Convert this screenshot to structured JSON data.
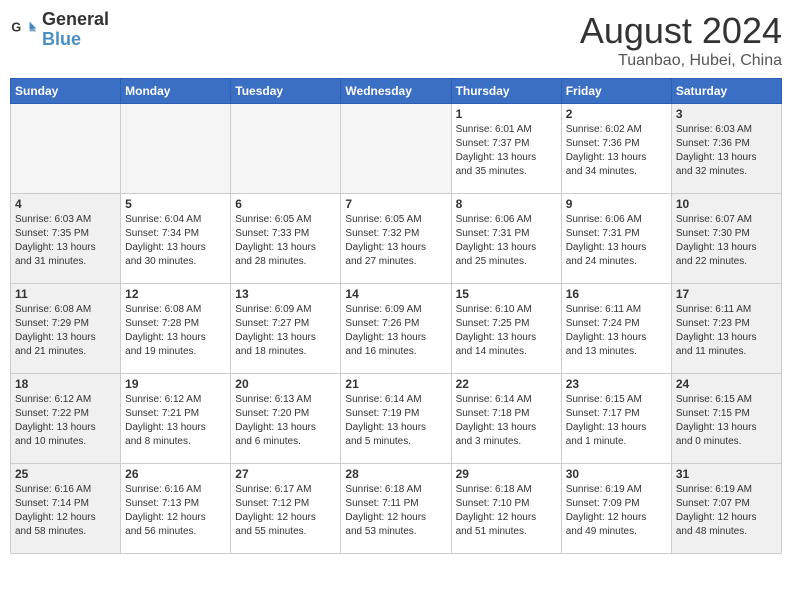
{
  "header": {
    "logo_line1": "General",
    "logo_line2": "Blue",
    "main_title": "August 2024",
    "sub_title": "Tuanbao, Hubei, China"
  },
  "days_of_week": [
    "Sunday",
    "Monday",
    "Tuesday",
    "Wednesday",
    "Thursday",
    "Friday",
    "Saturday"
  ],
  "weeks": [
    [
      {
        "day": "",
        "info": ""
      },
      {
        "day": "",
        "info": ""
      },
      {
        "day": "",
        "info": ""
      },
      {
        "day": "",
        "info": ""
      },
      {
        "day": "1",
        "info": "Sunrise: 6:01 AM\nSunset: 7:37 PM\nDaylight: 13 hours\nand 35 minutes."
      },
      {
        "day": "2",
        "info": "Sunrise: 6:02 AM\nSunset: 7:36 PM\nDaylight: 13 hours\nand 34 minutes."
      },
      {
        "day": "3",
        "info": "Sunrise: 6:03 AM\nSunset: 7:36 PM\nDaylight: 13 hours\nand 32 minutes."
      }
    ],
    [
      {
        "day": "4",
        "info": "Sunrise: 6:03 AM\nSunset: 7:35 PM\nDaylight: 13 hours\nand 31 minutes."
      },
      {
        "day": "5",
        "info": "Sunrise: 6:04 AM\nSunset: 7:34 PM\nDaylight: 13 hours\nand 30 minutes."
      },
      {
        "day": "6",
        "info": "Sunrise: 6:05 AM\nSunset: 7:33 PM\nDaylight: 13 hours\nand 28 minutes."
      },
      {
        "day": "7",
        "info": "Sunrise: 6:05 AM\nSunset: 7:32 PM\nDaylight: 13 hours\nand 27 minutes."
      },
      {
        "day": "8",
        "info": "Sunrise: 6:06 AM\nSunset: 7:31 PM\nDaylight: 13 hours\nand 25 minutes."
      },
      {
        "day": "9",
        "info": "Sunrise: 6:06 AM\nSunset: 7:31 PM\nDaylight: 13 hours\nand 24 minutes."
      },
      {
        "day": "10",
        "info": "Sunrise: 6:07 AM\nSunset: 7:30 PM\nDaylight: 13 hours\nand 22 minutes."
      }
    ],
    [
      {
        "day": "11",
        "info": "Sunrise: 6:08 AM\nSunset: 7:29 PM\nDaylight: 13 hours\nand 21 minutes."
      },
      {
        "day": "12",
        "info": "Sunrise: 6:08 AM\nSunset: 7:28 PM\nDaylight: 13 hours\nand 19 minutes."
      },
      {
        "day": "13",
        "info": "Sunrise: 6:09 AM\nSunset: 7:27 PM\nDaylight: 13 hours\nand 18 minutes."
      },
      {
        "day": "14",
        "info": "Sunrise: 6:09 AM\nSunset: 7:26 PM\nDaylight: 13 hours\nand 16 minutes."
      },
      {
        "day": "15",
        "info": "Sunrise: 6:10 AM\nSunset: 7:25 PM\nDaylight: 13 hours\nand 14 minutes."
      },
      {
        "day": "16",
        "info": "Sunrise: 6:11 AM\nSunset: 7:24 PM\nDaylight: 13 hours\nand 13 minutes."
      },
      {
        "day": "17",
        "info": "Sunrise: 6:11 AM\nSunset: 7:23 PM\nDaylight: 13 hours\nand 11 minutes."
      }
    ],
    [
      {
        "day": "18",
        "info": "Sunrise: 6:12 AM\nSunset: 7:22 PM\nDaylight: 13 hours\nand 10 minutes."
      },
      {
        "day": "19",
        "info": "Sunrise: 6:12 AM\nSunset: 7:21 PM\nDaylight: 13 hours\nand 8 minutes."
      },
      {
        "day": "20",
        "info": "Sunrise: 6:13 AM\nSunset: 7:20 PM\nDaylight: 13 hours\nand 6 minutes."
      },
      {
        "day": "21",
        "info": "Sunrise: 6:14 AM\nSunset: 7:19 PM\nDaylight: 13 hours\nand 5 minutes."
      },
      {
        "day": "22",
        "info": "Sunrise: 6:14 AM\nSunset: 7:18 PM\nDaylight: 13 hours\nand 3 minutes."
      },
      {
        "day": "23",
        "info": "Sunrise: 6:15 AM\nSunset: 7:17 PM\nDaylight: 13 hours\nand 1 minute."
      },
      {
        "day": "24",
        "info": "Sunrise: 6:15 AM\nSunset: 7:15 PM\nDaylight: 13 hours\nand 0 minutes."
      }
    ],
    [
      {
        "day": "25",
        "info": "Sunrise: 6:16 AM\nSunset: 7:14 PM\nDaylight: 12 hours\nand 58 minutes."
      },
      {
        "day": "26",
        "info": "Sunrise: 6:16 AM\nSunset: 7:13 PM\nDaylight: 12 hours\nand 56 minutes."
      },
      {
        "day": "27",
        "info": "Sunrise: 6:17 AM\nSunset: 7:12 PM\nDaylight: 12 hours\nand 55 minutes."
      },
      {
        "day": "28",
        "info": "Sunrise: 6:18 AM\nSunset: 7:11 PM\nDaylight: 12 hours\nand 53 minutes."
      },
      {
        "day": "29",
        "info": "Sunrise: 6:18 AM\nSunset: 7:10 PM\nDaylight: 12 hours\nand 51 minutes."
      },
      {
        "day": "30",
        "info": "Sunrise: 6:19 AM\nSunset: 7:09 PM\nDaylight: 12 hours\nand 49 minutes."
      },
      {
        "day": "31",
        "info": "Sunrise: 6:19 AM\nSunset: 7:07 PM\nDaylight: 12 hours\nand 48 minutes."
      }
    ]
  ]
}
